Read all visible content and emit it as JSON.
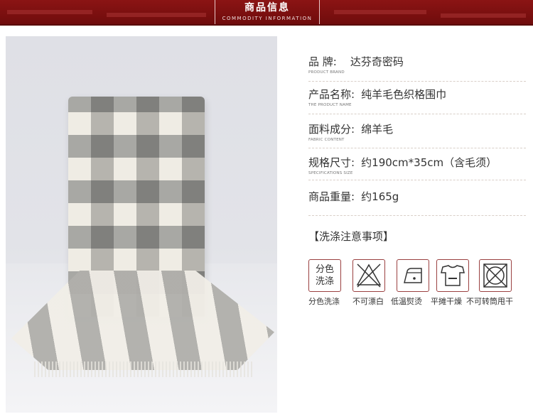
{
  "header": {
    "title": "商品信息",
    "subtitle": "COMMODITY INFORMATION",
    "color": "#7d1010"
  },
  "product": {
    "image": "plaid-wool-scarf-photo",
    "specs": [
      {
        "label": "品    牌:",
        "sub": "PRODUCT BRAND",
        "value": "达芬奇密码"
      },
      {
        "label": "产品名称:",
        "sub": "THE PRODUCT NAME",
        "value": "纯羊毛色织格围巾"
      },
      {
        "label": "面料成分:",
        "sub": "FABRIC CONTENT",
        "value": "绵羊毛"
      },
      {
        "label": "规格尺寸:",
        "sub": "SPECIFICATIONS SIZE",
        "value": "约190cm*35cm（含毛须）"
      },
      {
        "label": "商品重量:",
        "sub": "",
        "value": "约165g"
      }
    ]
  },
  "care": {
    "title": "【洗涤注意事项】",
    "items": [
      {
        "icon": "separate-wash-icon",
        "icon_text_1": "分色",
        "icon_text_2": "洗涤",
        "label": "分色洗涤"
      },
      {
        "icon": "no-bleach-icon",
        "label": "不可漂白"
      },
      {
        "icon": "low-temp-iron-icon",
        "label": "低温熨烫"
      },
      {
        "icon": "dry-flat-icon",
        "label": "平摊干燥"
      },
      {
        "icon": "no-tumble-dry-icon",
        "label": "不可转筒甩干"
      }
    ]
  }
}
